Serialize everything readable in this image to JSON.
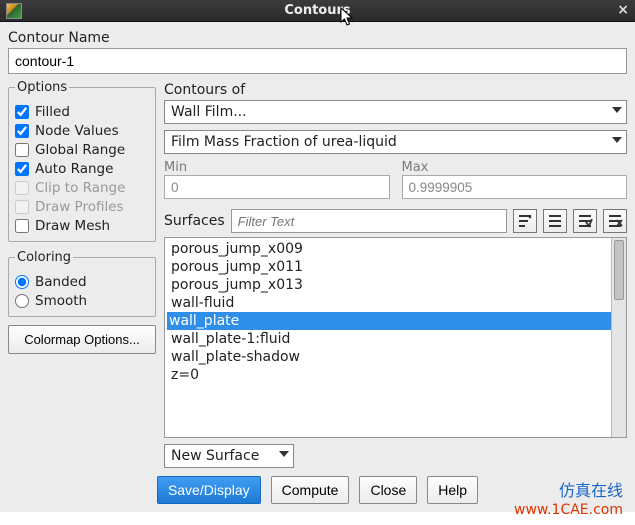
{
  "window": {
    "title": "Contours",
    "close_glyph": "×"
  },
  "contour_name_label": "Contour Name",
  "contour_name_value": "contour-1",
  "options": {
    "legend": "Options",
    "filled": "Filled",
    "node_values": "Node Values",
    "global_range": "Global Range",
    "auto_range": "Auto Range",
    "clip_to_range": "Clip to Range",
    "draw_profiles": "Draw Profiles",
    "draw_mesh": "Draw Mesh"
  },
  "coloring": {
    "legend": "Coloring",
    "banded": "Banded",
    "smooth": "Smooth"
  },
  "colormap_button": "Colormap Options...",
  "contours_of_label": "Contours of",
  "contours_of_primary": "Wall Film...",
  "contours_of_secondary": "Film Mass Fraction of urea-liquid",
  "min_label": "Min",
  "max_label": "Max",
  "min_value": "0",
  "max_value": "0.9999905",
  "surfaces_label": "Surfaces",
  "filter_placeholder": "Filter Text",
  "surfaces": {
    "items": [
      "porous_jump_x009",
      "porous_jump_x011",
      "porous_jump_x013",
      "wall-fluid",
      "wall_plate",
      "wall_plate-1:fluid",
      "wall_plate-shadow",
      "z=0"
    ],
    "selected_index": 4
  },
  "new_surface": "New Surface",
  "buttons": {
    "save_display": "Save/Display",
    "compute": "Compute",
    "close": "Close",
    "help": "Help"
  },
  "watermark": {
    "line1": "仿真在线",
    "line2": "www.1CAE.com"
  }
}
